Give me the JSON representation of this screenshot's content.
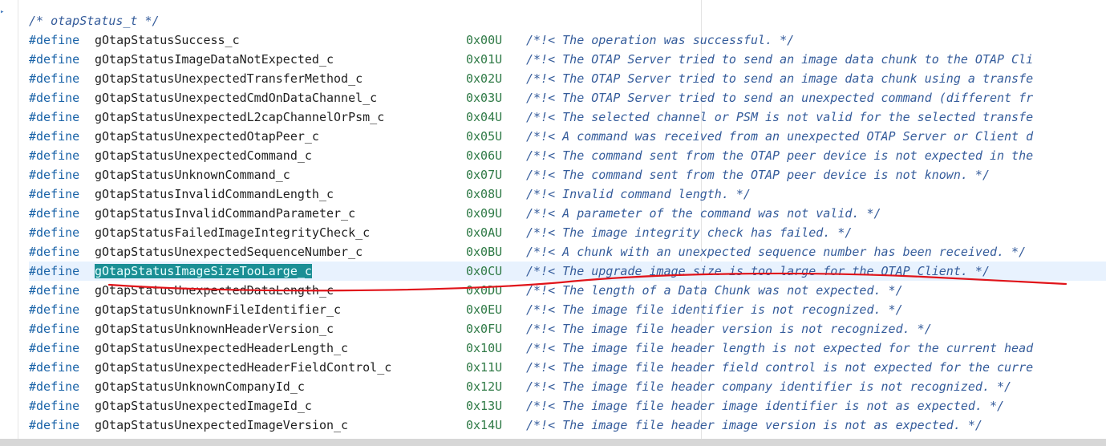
{
  "header_comment": "/* otapStatus_t */",
  "keyword": "#define",
  "highlight_color": "#1b8f95",
  "annotation_color": "#e0141a",
  "rows": [
    {
      "name": "gOtapStatusSuccess_c",
      "value": "0x00U",
      "comment": "/*!< The operation was successful. */"
    },
    {
      "name": "gOtapStatusImageDataNotExpected_c",
      "value": "0x01U",
      "comment": "/*!< The OTAP Server tried to send an image data chunk to the OTAP Cli"
    },
    {
      "name": "gOtapStatusUnexpectedTransferMethod_c",
      "value": "0x02U",
      "comment": "/*!< The OTAP Server tried to send an image data chunk using a transfe"
    },
    {
      "name": "gOtapStatusUnexpectedCmdOnDataChannel_c",
      "value": "0x03U",
      "comment": "/*!< The OTAP Server tried to send an unexpected command (different fr"
    },
    {
      "name": "gOtapStatusUnexpectedL2capChannelOrPsm_c",
      "value": "0x04U",
      "comment": "/*!< The selected channel or PSM is not valid for the selected transfe"
    },
    {
      "name": "gOtapStatusUnexpectedOtapPeer_c",
      "value": "0x05U",
      "comment": "/*!< A command was received from an unexpected OTAP Server or Client d"
    },
    {
      "name": "gOtapStatusUnexpectedCommand_c",
      "value": "0x06U",
      "comment": "/*!< The command sent from the OTAP peer device is not expected in the"
    },
    {
      "name": "gOtapStatusUnknownCommand_c",
      "value": "0x07U",
      "comment": "/*!< The command sent from the OTAP peer device is not known. */"
    },
    {
      "name": "gOtapStatusInvalidCommandLength_c",
      "value": "0x08U",
      "comment": "/*!< Invalid command length. */"
    },
    {
      "name": "gOtapStatusInvalidCommandParameter_c",
      "value": "0x09U",
      "comment": "/*!< A parameter of the command was not valid. */"
    },
    {
      "name": "gOtapStatusFailedImageIntegrityCheck_c",
      "value": "0x0AU",
      "comment": "/*!< The image integrity check has failed. */"
    },
    {
      "name": "gOtapStatusUnexpectedSequenceNumber_c",
      "value": "0x0BU",
      "comment": "/*!< A chunk with an unexpected sequence number has been received. */"
    },
    {
      "name": "gOtapStatusImageSizeTooLarge_c",
      "value": "0x0CU",
      "comment": "/*!< The upgrade image size is too large for the OTAP Client. */",
      "selected": true
    },
    {
      "name": "gOtapStatusUnexpectedDataLength_c",
      "value": "0x0DU",
      "comment": "/*!< The length of a Data Chunk was not expected. */"
    },
    {
      "name": "gOtapStatusUnknownFileIdentifier_c",
      "value": "0x0EU",
      "comment": "/*!< The image file identifier is not recognized. */"
    },
    {
      "name": "gOtapStatusUnknownHeaderVersion_c",
      "value": "0x0FU",
      "comment": "/*!< The image file header version is not recognized. */"
    },
    {
      "name": "gOtapStatusUnexpectedHeaderLength_c",
      "value": "0x10U",
      "comment": "/*!< The image file header length is not expected for the current head"
    },
    {
      "name": "gOtapStatusUnexpectedHeaderFieldControl_c",
      "value": "0x11U",
      "comment": "/*!< The image file header field control is not expected for the curre"
    },
    {
      "name": "gOtapStatusUnknownCompanyId_c",
      "value": "0x12U",
      "comment": "/*!< The image file header company identifier is not recognized. */"
    },
    {
      "name": "gOtapStatusUnexpectedImageId_c",
      "value": "0x13U",
      "comment": "/*!< The image file header image identifier is not as expected. */"
    },
    {
      "name": "gOtapStatusUnexpectedImageVersion_c",
      "value": "0x14U",
      "comment": "/*!< The image file header image version is not as expected. */"
    }
  ]
}
